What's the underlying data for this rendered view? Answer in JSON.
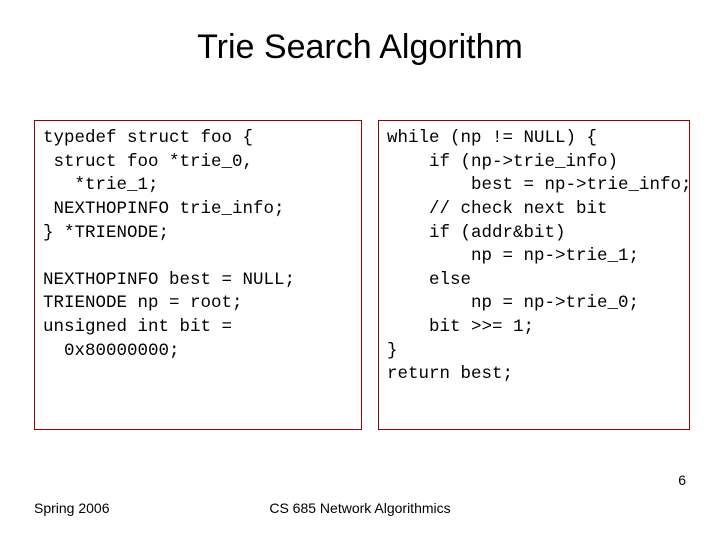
{
  "title": "Trie Search Algorithm",
  "left_code": "typedef struct foo {\n struct foo *trie_0,\n   *trie_1;\n NEXTHOPINFO trie_info;\n} *TRIENODE;\n\nNEXTHOPINFO best = NULL;\nTRIENODE np = root;\nunsigned int bit =\n  0x80000000;",
  "right_code": "while (np != NULL) {\n    if (np->trie_info)\n        best = np->trie_info;\n    // check next bit\n    if (addr&bit)\n        np = np->trie_1;\n    else\n        np = np->trie_0;\n    bit >>= 1;\n}\nreturn best;",
  "footer_left": "Spring 2006",
  "footer_center": "CS 685 Network Algorithmics",
  "page_number": "6"
}
